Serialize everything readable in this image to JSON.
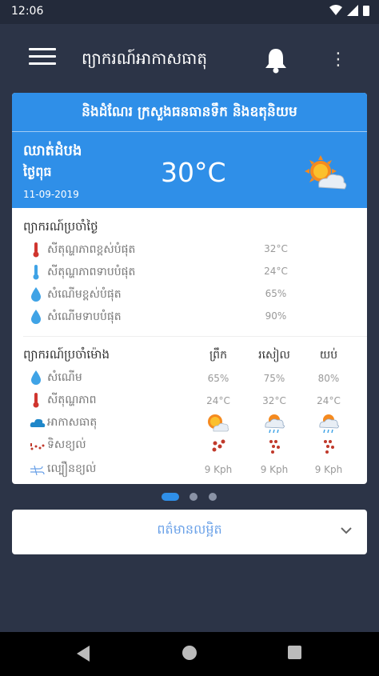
{
  "status_bar": {
    "time": "12:06"
  },
  "app_bar": {
    "title": "ព្យាករណ៍អាកាសធាតុ"
  },
  "banner": "និងដំណែរ ក្រសួងធនធានទឹក និងឧតុនិយម",
  "current": {
    "location": "ឈាត់ដំបង",
    "day": "ថ្ងៃពុធ",
    "date": "11-09-2019",
    "temperature": "30°C",
    "icon": "partly-cloudy-sun-icon"
  },
  "today": {
    "title": "ព្យាករណ៍ប្រចាំថ្ងៃ",
    "rows": [
      {
        "label": "សីតុណ្ហភាពខ្ពស់បំផុត",
        "value": "32°C",
        "icon": "thermometer-icon"
      },
      {
        "label": "សីតុណ្ហភាពទាបបំផុត",
        "value": "24°C",
        "icon": "thermometer-icon"
      },
      {
        "label": "សំណើមខ្ពស់បំផុត",
        "value": "65%",
        "icon": "droplet-icon"
      },
      {
        "label": "សំណើមទាបបំផុត",
        "value": "90%",
        "icon": "droplet-icon"
      }
    ]
  },
  "periods": {
    "title": "ព្យាករណ៍ប្រចាំម៉ោង",
    "columns": [
      "ព្រឹក",
      "រសៀល",
      "យប់"
    ],
    "rows": [
      {
        "label": "សំណើម",
        "icon": "droplet-icon",
        "values": [
          "65%",
          "75%",
          "80%"
        ]
      },
      {
        "label": "សីតុណ្ហភាព",
        "icon": "thermometer-icon",
        "values": [
          "24°C",
          "32°C",
          "24°C"
        ]
      },
      {
        "label": "អាកាសធាតុ",
        "icon": "cloud-icon",
        "values": [
          "partly-sunny-icon",
          "rain-cloud-icon",
          "rain-cloud-icon"
        ]
      },
      {
        "label": "ទិសខ្យល់",
        "icon": "wind-direction-icon",
        "values": [
          "wind-dots-icon",
          "wind-dots-icon",
          "wind-dots-icon"
        ]
      },
      {
        "label": "ល្បឿនខ្យល់",
        "icon": "wind-speed-icon",
        "values": [
          "9 Kph",
          "9 Kph",
          "9 Kph"
        ]
      }
    ]
  },
  "pager": {
    "count": 3,
    "active": 0
  },
  "more_info": {
    "label": "ពត៌មានលម្អិត"
  },
  "colors": {
    "accent": "#2f8fe8",
    "background": "#2c3447",
    "thermometer": "#d0362f",
    "droplet": "#3fa3e6"
  }
}
